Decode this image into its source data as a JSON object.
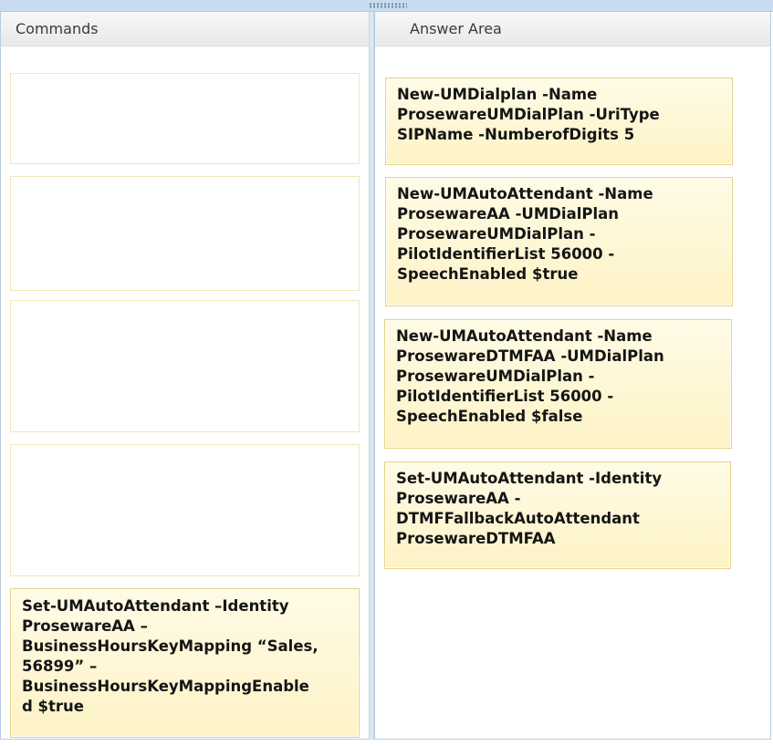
{
  "panels": {
    "commands_title": "Commands",
    "answer_title": "Answer Area"
  },
  "commands": {
    "cards": [
      {
        "text": "Set-UMAutoAttendant –Identity\nProsewareAA –\nBusinessHoursKeyMapping “Sales,\n56899” –\nBusinessHoursKeyMappingEnable\nd $true"
      }
    ]
  },
  "answer": {
    "cards": [
      {
        "text": "New-UMDialplan -Name\nProsewareUMDialPlan -UriType\nSIPName -NumberofDigits 5"
      },
      {
        "text": "New-UMAutoAttendant -Name\nProsewareAA -UMDialPlan\nProsewareUMDialPlan -\nPilotIdentifierList 56000 -\nSpeechEnabled $true"
      },
      {
        "text": "New-UMAutoAttendant -Name\nProsewareDTMFAA -UMDialPlan\nProsewareUMDialPlan -\nPilotIdentifierList 56000 -\nSpeechEnabled $false"
      },
      {
        "text": "Set-UMAutoAttendant -Identity\nProsewareAA -\nDTMFFallbackAutoAttendant\nProsewareDTMFAA"
      }
    ]
  }
}
